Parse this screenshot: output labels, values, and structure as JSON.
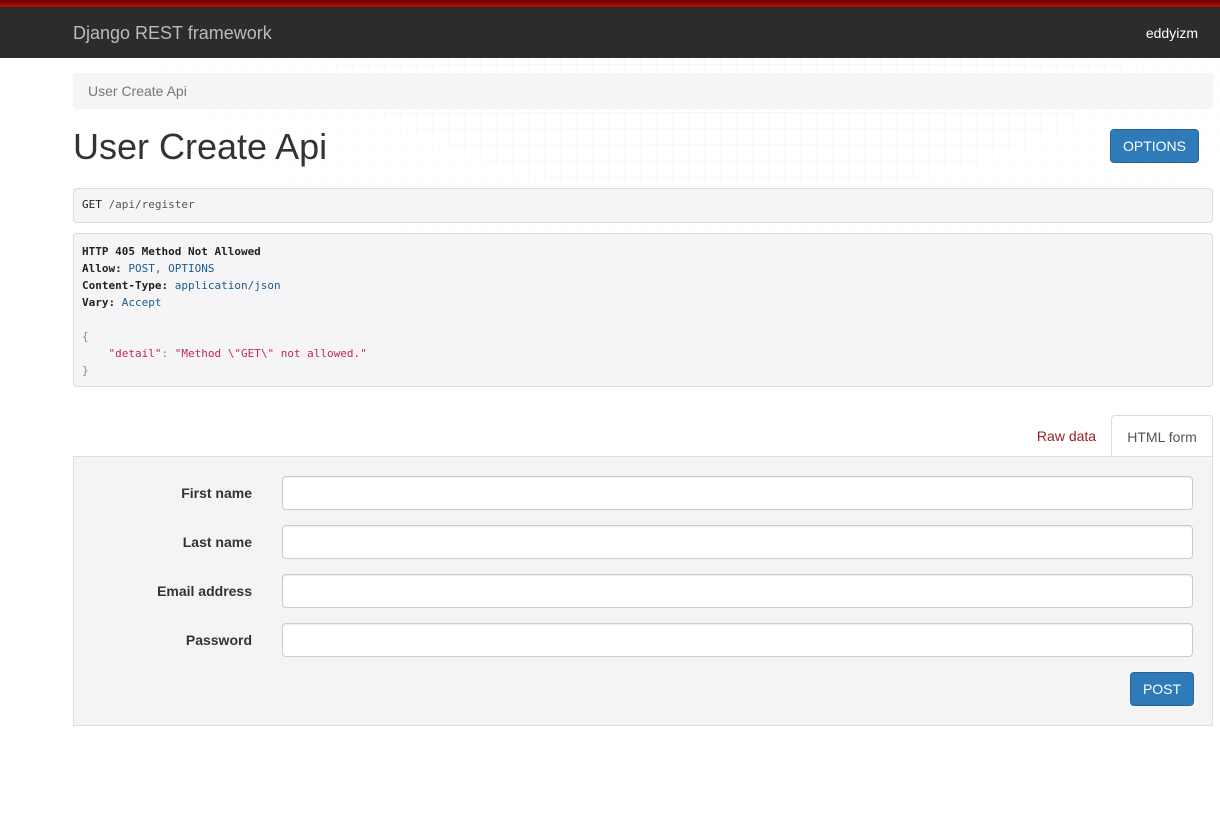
{
  "navbar": {
    "brand": "Django REST framework",
    "user": "eddyizm",
    "accent_color": "#a30000",
    "background_color": "#2c2c2c"
  },
  "breadcrumb": {
    "label": "User Create Api"
  },
  "page": {
    "title": "User Create Api",
    "options_label": "OPTIONS"
  },
  "request": {
    "method": "GET",
    "path": "/api/register"
  },
  "response": {
    "status_line": "HTTP 405 Method Not Allowed",
    "headers": [
      {
        "name": "Allow:",
        "value": "POST, OPTIONS"
      },
      {
        "name": "Content-Type:",
        "value": "application/json"
      },
      {
        "name": "Vary:",
        "value": "Accept"
      }
    ],
    "body": {
      "open": "{",
      "key": "\"detail\"",
      "sep": ":",
      "value": "\"Method \\\"GET\\\" not allowed.\"",
      "close": "}"
    }
  },
  "tabs": {
    "raw": "Raw data",
    "html": "HTML form",
    "active": "HTML form"
  },
  "form": {
    "fields": [
      {
        "label": "First name",
        "value": ""
      },
      {
        "label": "Last name",
        "value": ""
      },
      {
        "label": "Email address",
        "value": ""
      },
      {
        "label": "Password",
        "value": ""
      }
    ],
    "submit_label": "POST"
  },
  "colors": {
    "primary_button": "#2f7ab8",
    "link": "#9b1c1c"
  }
}
